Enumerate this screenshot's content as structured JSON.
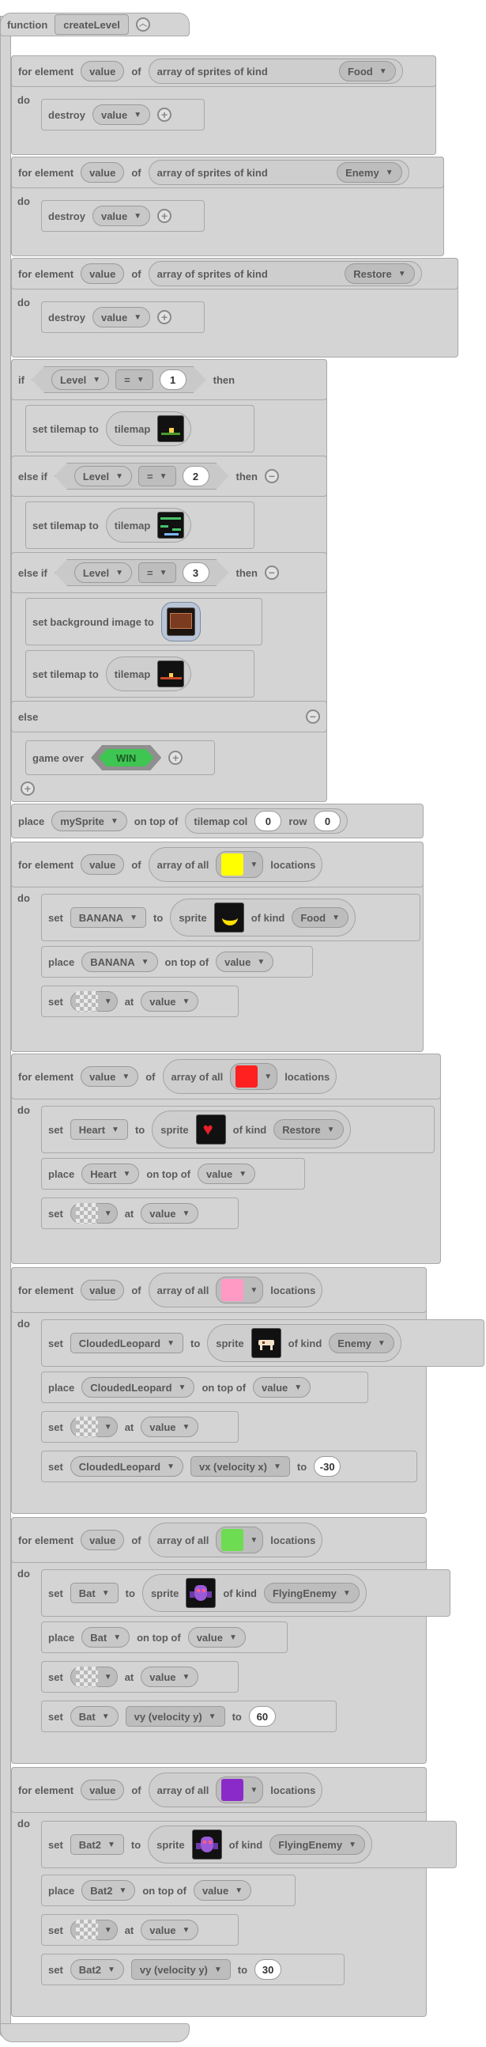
{
  "func": {
    "keyword": "function",
    "name": "createLevel",
    "collapse_icon": "chevron-up-icon"
  },
  "kw": {
    "for_element": "for element",
    "of": "of",
    "do": "do",
    "destroy": "destroy",
    "array_sprites_kind": "array of sprites of kind",
    "array_all": "array of all",
    "locations": "locations",
    "if": "if",
    "then": "then",
    "else_if": "else if",
    "else": "else",
    "set_tilemap_to": "set tilemap to",
    "tilemap": "tilemap",
    "set_bg_image_to": "set background image to",
    "game_over": "game over",
    "place": "place",
    "on_top_of": "on top of",
    "tilemap_col": "tilemap col",
    "row": "row",
    "set": "set",
    "to": "to",
    "sprite": "sprite",
    "of_kind": "of kind",
    "at": "at",
    "value": "value",
    "eq": "=",
    "level": "Level"
  },
  "destroy_loops": [
    {
      "kind": "Food"
    },
    {
      "kind": "Enemy"
    },
    {
      "kind": "Restore"
    }
  ],
  "if_block": {
    "cond1": "1",
    "cond2": "2",
    "cond3": "3",
    "game_over_label": "WIN",
    "game_over_color": "#3fc552"
  },
  "place_my_sprite": {
    "sprite": "mySprite",
    "col": "0",
    "row": "0"
  },
  "tile_loops": [
    {
      "color": "#ffff00",
      "var": "BANANA",
      "kind": "Food",
      "icon": "banana-icon"
    },
    {
      "color": "#ff2020",
      "var": "Heart",
      "kind": "Restore",
      "icon": "heart-icon"
    },
    {
      "color": "#ff9ac4",
      "var": "CloudedLeopard",
      "kind": "Enemy",
      "icon": "leopard-icon",
      "prop": "vx (velocity x)",
      "prop_val": "-30"
    },
    {
      "color": "#6ddc52",
      "var": "Bat",
      "kind": "FlyingEnemy",
      "icon": "bat-icon",
      "prop": "vy (velocity y)",
      "prop_val": "60"
    },
    {
      "color": "#8a2bc9",
      "var": "Bat2",
      "kind": "FlyingEnemy",
      "icon": "bat-icon",
      "prop": "vy (velocity y)",
      "prop_val": "30"
    }
  ]
}
